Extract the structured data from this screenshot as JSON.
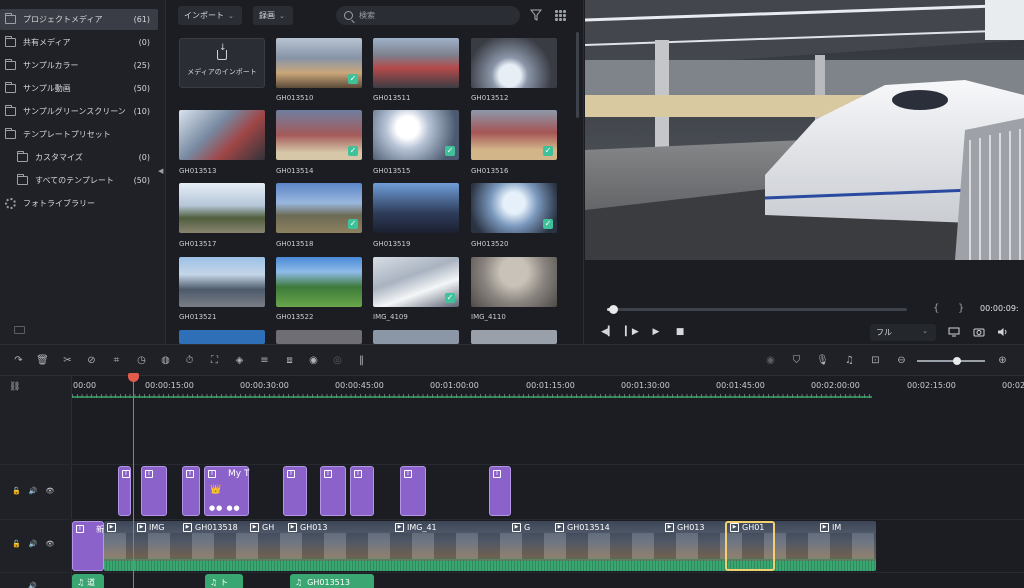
{
  "sidebar": {
    "items": [
      {
        "label": "プロジェクトメディア",
        "count": "(61)"
      },
      {
        "label": "共有メディア",
        "count": "(0)"
      },
      {
        "label": "サンプルカラー",
        "count": "(25)"
      },
      {
        "label": "サンプル動画",
        "count": "(50)"
      },
      {
        "label": "サンプルグリーンスクリーン",
        "count": "(10)"
      },
      {
        "label": "テンプレートプリセット",
        "count": ""
      },
      {
        "label": "カスタマイズ",
        "count": "(0)"
      },
      {
        "label": "すべてのテンプレート",
        "count": "(50)"
      },
      {
        "label": "フォトライブラリー",
        "count": ""
      }
    ]
  },
  "media": {
    "import_dropdown": "インポート",
    "record_dropdown": "録画",
    "search_placeholder": "検索",
    "import_tile_label": "メディアのインポート",
    "tiles": [
      "GH013510",
      "GH013511",
      "GH013512",
      "GH013513",
      "GH013514",
      "GH013515",
      "GH013516",
      "GH013517",
      "GH013518",
      "GH013519",
      "GH013520",
      "GH013521",
      "GH013522",
      "IMG_4109",
      "IMG_4110"
    ]
  },
  "viewer": {
    "timecode": "00:00:09:",
    "quality": "フル",
    "progress": 0.02
  },
  "timeline": {
    "ruler": [
      "00:00",
      "00:00:15:00",
      "00:00:30:00",
      "00:00:45:00",
      "00:01:00:00",
      "00:01:15:00",
      "00:01:30:00",
      "00:01:45:00",
      "00:02:00:00",
      "00:02:15:00",
      "00:02"
    ],
    "title_clip": "My T",
    "video_clips": [
      "新",
      "IMG",
      "GH013518",
      "GH",
      "GH013",
      "IMG_41",
      "G",
      "GH013514",
      "GH013",
      "GH01",
      "IM"
    ],
    "audio_clips": [
      "道",
      "ト",
      "GH013513"
    ]
  },
  "colors": {
    "accent_green": "#3fc19a",
    "title_purple": "#8b62c9",
    "audio_green": "#3aa672",
    "playhead": "#e25b4b"
  }
}
